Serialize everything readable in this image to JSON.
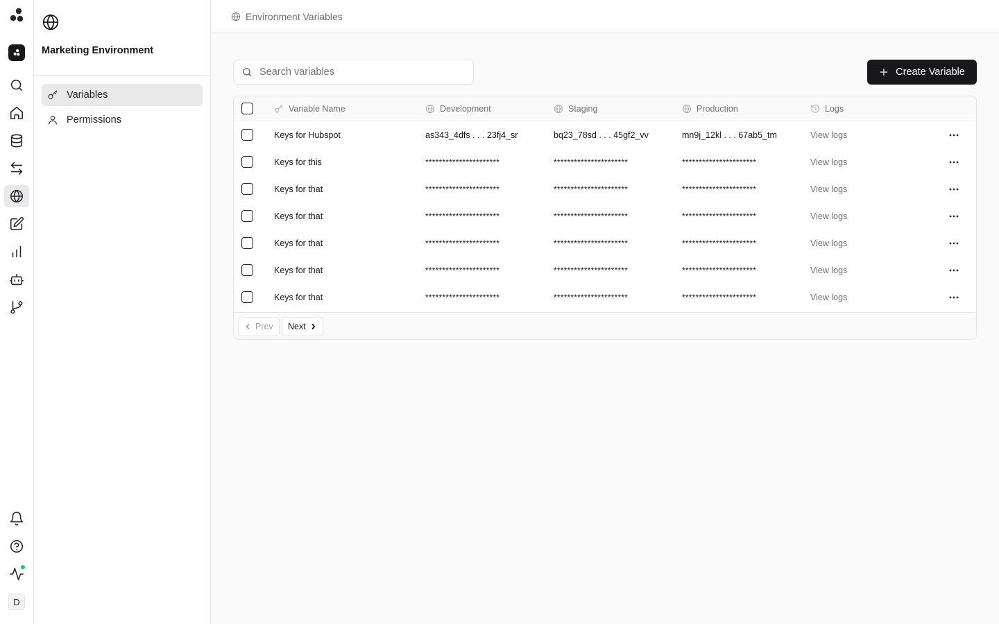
{
  "rail": {
    "items": [
      {
        "name": "search",
        "icon": "search-icon"
      },
      {
        "name": "home",
        "icon": "home-icon"
      },
      {
        "name": "database",
        "icon": "database-icon"
      },
      {
        "name": "transfer",
        "icon": "arrows-transfer-icon"
      },
      {
        "name": "environments",
        "icon": "globe-icon",
        "active": true
      },
      {
        "name": "edit",
        "icon": "edit-icon"
      },
      {
        "name": "analytics",
        "icon": "bar-chart-icon"
      },
      {
        "name": "bot",
        "icon": "bot-icon"
      },
      {
        "name": "git",
        "icon": "git-branch-icon"
      }
    ],
    "bottom": [
      {
        "name": "notifications",
        "icon": "bell-icon"
      },
      {
        "name": "help",
        "icon": "help-icon"
      },
      {
        "name": "activity",
        "icon": "activity-icon"
      }
    ],
    "avatar_initial": "D",
    "status_color": "#22c55e"
  },
  "sidebar": {
    "title": "Marketing Environment",
    "items": [
      {
        "label": "Variables",
        "icon": "key-icon",
        "active": true
      },
      {
        "label": "Permissions",
        "icon": "user-icon",
        "active": false
      }
    ]
  },
  "header": {
    "breadcrumb": "Environment Variables"
  },
  "toolbar": {
    "search_placeholder": "Search variables",
    "create_label": "Create Variable"
  },
  "table": {
    "columns": {
      "name": "Variable Name",
      "development": "Development",
      "staging": "Staging",
      "production": "Production",
      "logs": "Logs"
    },
    "rows": [
      {
        "name": "Keys for Hubspot",
        "dev": "as343_4dfs . . . 23fj4_sr",
        "stg": "bq23_78sd . . . 45gf2_vv",
        "prod": "mn9j_12kl . . . 67ab5_tm",
        "logs": "View logs"
      },
      {
        "name": "Keys for this",
        "dev": "**********************",
        "stg": "**********************",
        "prod": "**********************",
        "logs": "View logs"
      },
      {
        "name": "Keys for that",
        "dev": "**********************",
        "stg": "**********************",
        "prod": "**********************",
        "logs": "View logs"
      },
      {
        "name": "Keys for that",
        "dev": "**********************",
        "stg": "**********************",
        "prod": "**********************",
        "logs": "View logs"
      },
      {
        "name": "Keys for that",
        "dev": "**********************",
        "stg": "**********************",
        "prod": "**********************",
        "logs": "View logs"
      },
      {
        "name": "Keys for that",
        "dev": "**********************",
        "stg": "**********************",
        "prod": "**********************",
        "logs": "View logs"
      },
      {
        "name": "Keys for that",
        "dev": "**********************",
        "stg": "**********************",
        "prod": "**********************",
        "logs": "View logs"
      }
    ]
  },
  "pagination": {
    "prev_label": "Prev",
    "next_label": "Next"
  },
  "colors": {
    "accent": "#18181b",
    "border": "#e4e4e7",
    "muted_text": "#71717a"
  }
}
